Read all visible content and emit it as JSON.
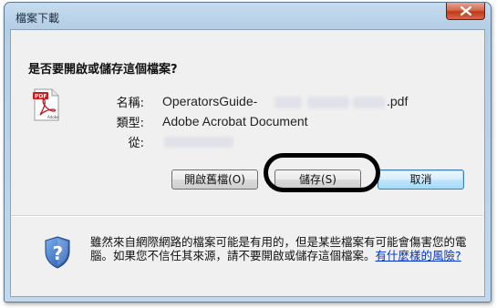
{
  "window": {
    "title": "檔案下載"
  },
  "dialog": {
    "question": "是否要開啟或儲存這個檔案?",
    "file": {
      "icon": "pdf-file-icon",
      "name_label": "名稱:",
      "name_prefix": "OperatorsGuide-",
      "name_suffix": ".pdf",
      "type_label": "類型:",
      "type_value": "Adobe Acrobat Document",
      "from_label": "從:"
    },
    "buttons": {
      "open": "開啟舊檔(O)",
      "save": "儲存(S)",
      "cancel": "取消"
    },
    "warning": {
      "icon": "security-shield-icon",
      "text": "雖然來自網際網路的檔案可能是有用的，但是某些檔案有可能會傷害您的電腦。如果您不信任其來源，請不要開啟或儲存這個檔案。",
      "link": "有什麼樣的風險?"
    },
    "colors": {
      "accent": "#3c7fb1",
      "link": "#0033cc",
      "highlight": "#000000",
      "close_button": "#c0391b"
    }
  }
}
